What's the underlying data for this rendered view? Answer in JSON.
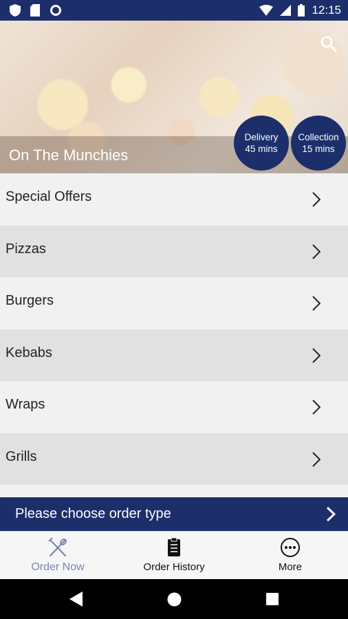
{
  "status_bar": {
    "time": "12:15",
    "icons": [
      "shield-icon",
      "sd-card-icon",
      "sync-icon",
      "wifi-icon",
      "signal-icon",
      "battery-icon"
    ]
  },
  "restaurant": {
    "name": "On The Munchies"
  },
  "badges": {
    "delivery": {
      "label": "Delivery",
      "time": "45 mins"
    },
    "collection": {
      "label": "Collection",
      "time": "15 mins"
    }
  },
  "menu": {
    "items": [
      "Special Offers",
      "Pizzas",
      "Burgers",
      "Kebabs",
      "Wraps",
      "Grills"
    ]
  },
  "order_bar": {
    "text": "Please choose order type"
  },
  "tabs": {
    "order_now": "Order Now",
    "order_history": "Order History",
    "more": "More"
  },
  "colors": {
    "primary": "#1c2f6b",
    "active_tab": "#7a86b4",
    "row_light": "#f1f1f1",
    "row_dark": "#e1e1e1"
  }
}
